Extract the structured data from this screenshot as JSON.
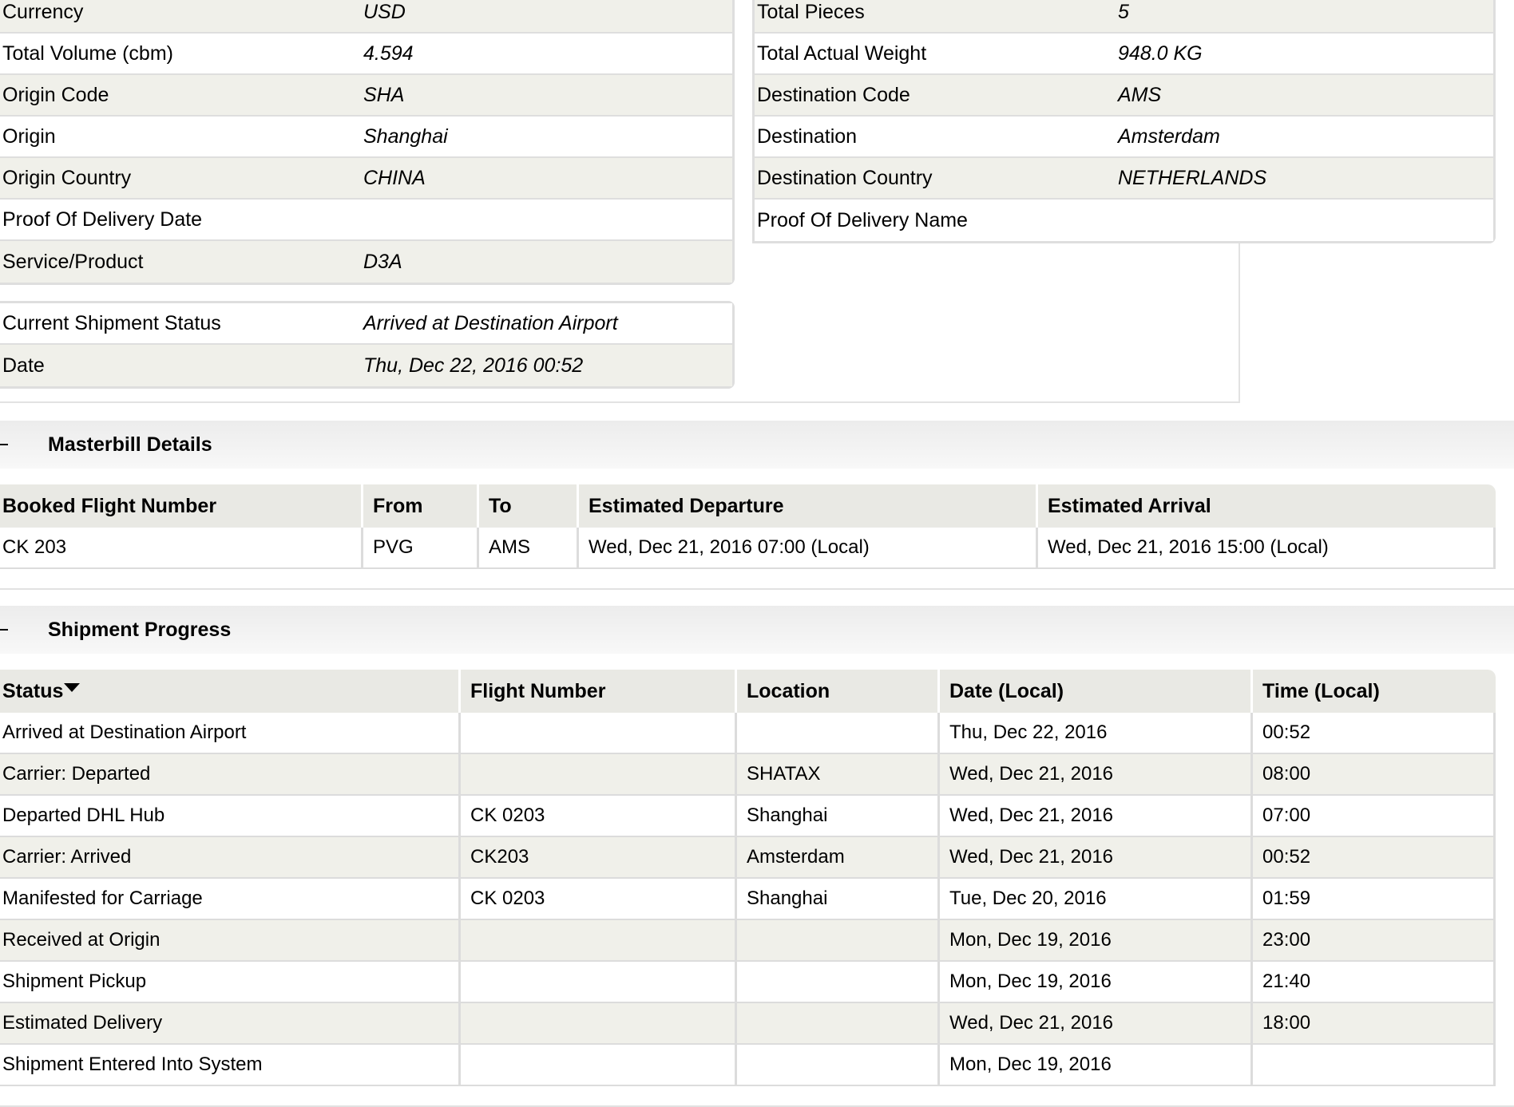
{
  "summary_left": [
    {
      "label": "Currency",
      "value": "USD"
    },
    {
      "label": "Total Volume (cbm)",
      "value": "4.594"
    },
    {
      "label": "Origin Code",
      "value": "SHA"
    },
    {
      "label": "Origin",
      "value": "Shanghai"
    },
    {
      "label": "Origin Country",
      "value": "CHINA"
    },
    {
      "label": "Proof Of Delivery Date",
      "value": ""
    },
    {
      "label": "Service/Product",
      "value": "D3A"
    }
  ],
  "summary_right": [
    {
      "label": "Total Pieces",
      "value": "5"
    },
    {
      "label": "Total Actual Weight",
      "value": "948.0 KG"
    },
    {
      "label": "Destination Code",
      "value": "AMS"
    },
    {
      "label": "Destination",
      "value": "Amsterdam"
    },
    {
      "label": "Destination Country",
      "value": "NETHERLANDS"
    },
    {
      "label": "Proof Of Delivery Name",
      "value": ""
    }
  ],
  "status_block": [
    {
      "label": "Current Shipment Status",
      "value": "Arrived at Destination Airport"
    },
    {
      "label": "Date",
      "value": "Thu, Dec 22, 2016 00:52"
    }
  ],
  "masterbill": {
    "title": "Masterbill Details",
    "headers": [
      "Booked Flight Number",
      "From",
      "To",
      "Estimated Departure",
      "Estimated Arrival"
    ],
    "rows": [
      [
        "CK 203",
        "PVG",
        "AMS",
        "Wed, Dec 21, 2016 07:00 (Local)",
        "Wed, Dec 21, 2016 15:00 (Local)"
      ]
    ]
  },
  "progress": {
    "title": "Shipment Progress",
    "headers": [
      "Status",
      "Flight Number",
      "Location",
      "Date (Local)",
      "Time (Local)"
    ],
    "rows": [
      [
        "Arrived at Destination Airport",
        "",
        "",
        "Thu, Dec 22, 2016",
        "00:52"
      ],
      [
        "Carrier: Departed",
        "",
        "SHATAX",
        "Wed, Dec 21, 2016",
        "08:00"
      ],
      [
        "Departed DHL Hub",
        "CK 0203",
        "Shanghai",
        "Wed, Dec 21, 2016",
        "07:00"
      ],
      [
        "Carrier: Arrived",
        "CK203",
        "Amsterdam",
        "Wed, Dec 21, 2016",
        "00:52"
      ],
      [
        "Manifested for Carriage",
        "CK 0203",
        "Shanghai",
        "Tue, Dec 20, 2016",
        "01:59"
      ],
      [
        "Received at Origin",
        "",
        "",
        "Mon, Dec 19, 2016",
        "23:00"
      ],
      [
        "Shipment Pickup",
        "",
        "",
        "Mon, Dec 19, 2016",
        "21:40"
      ],
      [
        "Estimated Delivery",
        "",
        "",
        "Wed, Dec 21, 2016",
        "18:00"
      ],
      [
        "Shipment Entered Into System",
        "",
        "",
        "Mon, Dec 19, 2016",
        ""
      ]
    ]
  },
  "icons": {
    "collapse": "collapse-minus-icon",
    "sort": "sort-descending-icon"
  }
}
